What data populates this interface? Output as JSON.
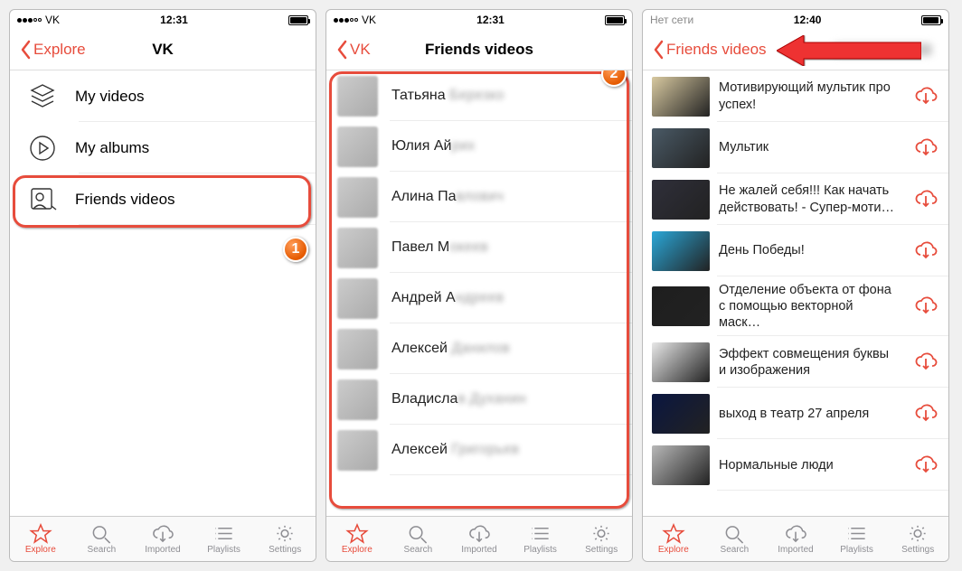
{
  "phones": [
    {
      "status": {
        "left": "VK",
        "dots_full": 3,
        "dots_empty": 2,
        "time": "12:31",
        "battery": 95
      },
      "nav": {
        "back": "Explore",
        "title": "VK"
      },
      "menu": [
        {
          "label": "My videos",
          "icon": "stack"
        },
        {
          "label": "My albums",
          "icon": "play"
        },
        {
          "label": "Friends videos",
          "icon": "person"
        }
      ]
    },
    {
      "status": {
        "left": "VK",
        "dots_full": 3,
        "dots_empty": 2,
        "time": "12:31",
        "battery": 95
      },
      "nav": {
        "back": "VK",
        "title": "Friends videos"
      },
      "friends": [
        {
          "visible": "Татьяна ",
          "blurred": "Березко"
        },
        {
          "visible": "Юлия Ай",
          "blurred": "рих"
        },
        {
          "visible": "Алина Па",
          "blurred": "влович"
        },
        {
          "visible": "Павел М",
          "blurred": "океев"
        },
        {
          "visible": "Андрей А",
          "blurred": "ндреев"
        },
        {
          "visible": "Алексей ",
          "blurred": "Данилов"
        },
        {
          "visible": "Владисла",
          "blurred": "в Духанин"
        },
        {
          "visible": "Алексей ",
          "blurred": "Григорьев"
        }
      ]
    },
    {
      "status": {
        "left": "Нет сети",
        "dots_full": 0,
        "dots_empty": 0,
        "time": "12:40",
        "battery": 92
      },
      "nav": {
        "back": "Friends videos",
        "title": ""
      },
      "videos": [
        {
          "title": "Мотивирующий мультик про успех!",
          "thumb": "#d8c9a0"
        },
        {
          "title": "Мультик",
          "thumb": "#4a5a66"
        },
        {
          "title": "Не жалей себя!!! Как начать действовать! - Супер-моти…",
          "thumb": "#2f2f3a"
        },
        {
          "title": "День Победы!",
          "thumb": "#2aa7d8"
        },
        {
          "title": "Отделение объекта от фона с помощью векторной маск…",
          "thumb": "#1e1e1e"
        },
        {
          "title": "Эффект совмещения буквы и изображения",
          "thumb": "#e8e8e8"
        },
        {
          "title": "выход в театр 27 апреля",
          "thumb": "#0a1640"
        },
        {
          "title": "Нормальные люди",
          "thumb": "#b8b8b8"
        }
      ]
    }
  ],
  "tabs": [
    {
      "label": "Explore",
      "icon": "star"
    },
    {
      "label": "Search",
      "icon": "search"
    },
    {
      "label": "Imported",
      "icon": "cloud-down"
    },
    {
      "label": "Playlists",
      "icon": "list"
    },
    {
      "label": "Settings",
      "icon": "gear"
    }
  ],
  "badges": {
    "b1": "1",
    "b2": "2"
  }
}
